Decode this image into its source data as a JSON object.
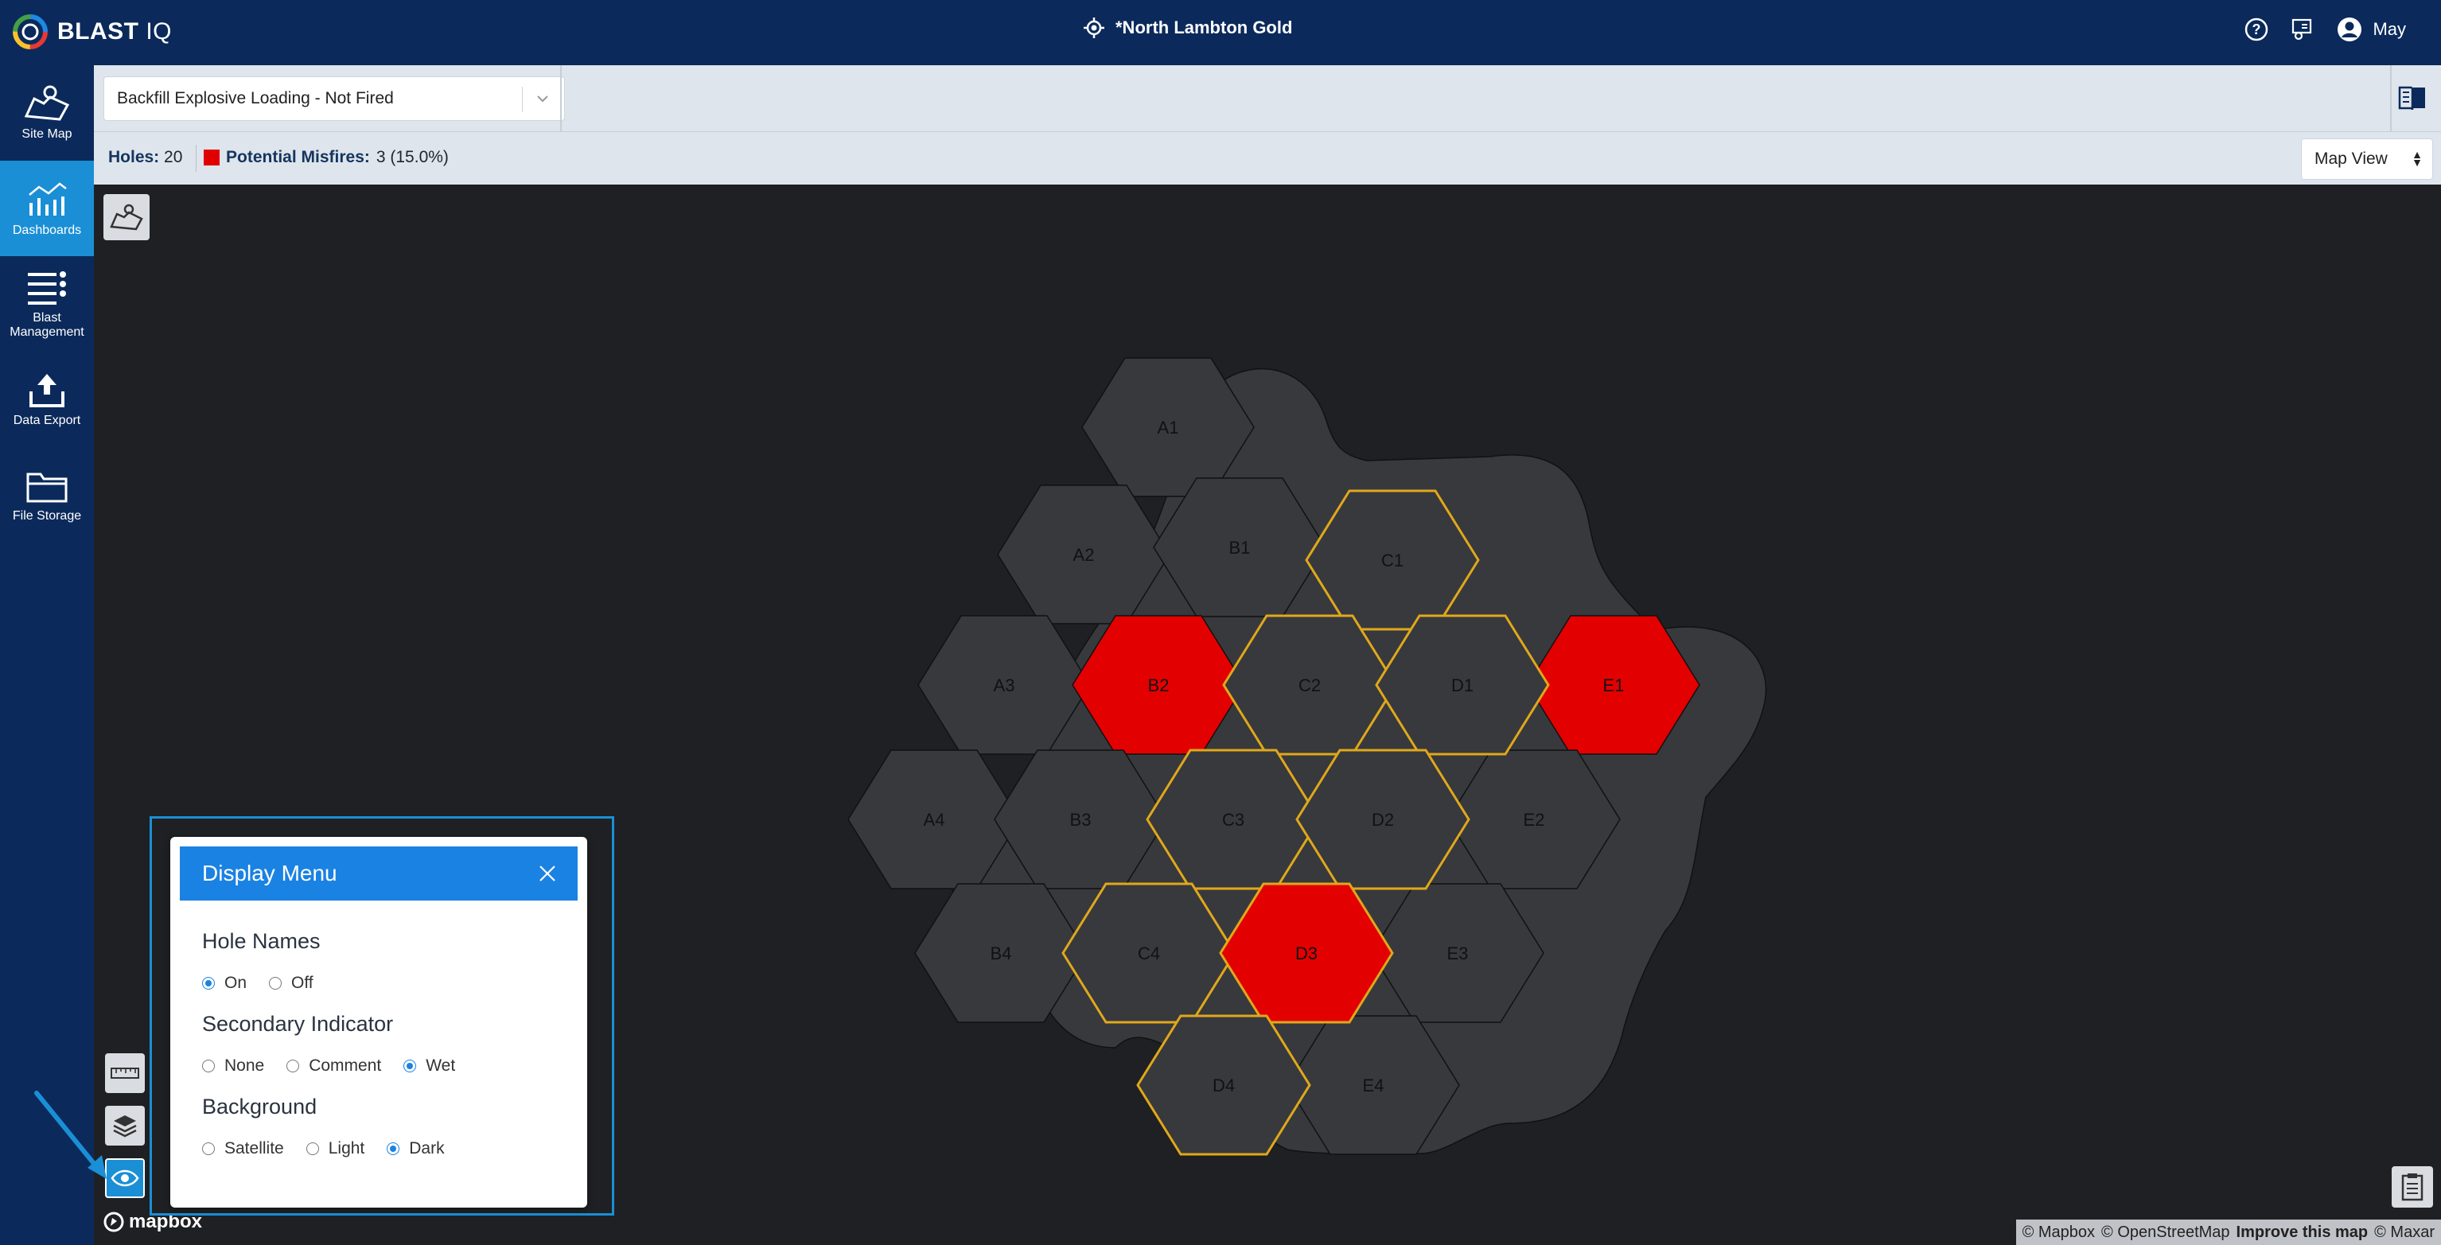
{
  "header": {
    "logo_text_bold": "BLAST",
    "logo_text_light": "IQ",
    "site_name": "*North Lambton Gold",
    "user_name": "May",
    "icons": [
      "help-icon",
      "sites-icon",
      "user-icon",
      "locate-icon"
    ]
  },
  "sidebar": {
    "items": [
      {
        "label": "Site Map",
        "icon": "map-icon",
        "active": false
      },
      {
        "label": "Dashboards",
        "icon": "dashboard-icon",
        "active": true
      },
      {
        "label": "Blast Management",
        "icon": "list-icon",
        "active": false
      },
      {
        "label": "Data Export",
        "icon": "upload-icon",
        "active": false
      },
      {
        "label": "File Storage",
        "icon": "folder-icon",
        "active": false
      }
    ]
  },
  "toolbar": {
    "dashboard_select": "Backfill Explosive Loading - Not Fired",
    "holes_label": "Holes:",
    "holes_count": "20",
    "misfires_label": "Potential Misfires:",
    "misfires_value": "3 (15.0%)",
    "view_select": "Map View"
  },
  "map": {
    "holes": [
      {
        "name": "A1",
        "status": "normal",
        "outline": false
      },
      {
        "name": "A2",
        "status": "normal",
        "outline": false
      },
      {
        "name": "A3",
        "status": "normal",
        "outline": false
      },
      {
        "name": "A4",
        "status": "normal",
        "outline": false
      },
      {
        "name": "B1",
        "status": "normal",
        "outline": false
      },
      {
        "name": "B2",
        "status": "misfire",
        "outline": false
      },
      {
        "name": "B3",
        "status": "normal",
        "outline": false
      },
      {
        "name": "B4",
        "status": "normal",
        "outline": false
      },
      {
        "name": "C1",
        "status": "normal",
        "outline": true
      },
      {
        "name": "C2",
        "status": "normal",
        "outline": true
      },
      {
        "name": "C3",
        "status": "normal",
        "outline": true
      },
      {
        "name": "C4",
        "status": "normal",
        "outline": true
      },
      {
        "name": "D1",
        "status": "normal",
        "outline": true
      },
      {
        "name": "D2",
        "status": "normal",
        "outline": true
      },
      {
        "name": "D3",
        "status": "misfire",
        "outline": true
      },
      {
        "name": "D4",
        "status": "normal",
        "outline": true
      },
      {
        "name": "E1",
        "status": "misfire",
        "outline": false
      },
      {
        "name": "E2",
        "status": "normal",
        "outline": false
      },
      {
        "name": "E3",
        "status": "normal",
        "outline": false
      },
      {
        "name": "E4",
        "status": "normal",
        "outline": false
      }
    ],
    "colors": {
      "normal": "#38393d",
      "misfire": "#e30000",
      "wet_outline": "#e0a81a",
      "background": "#1f2023"
    },
    "attribution": {
      "mapbox": "© Mapbox",
      "osm": "© OpenStreetMap",
      "improve": "Improve this map",
      "maxar": "© Maxar"
    },
    "mapbox_logo": "mapbox"
  },
  "display_menu": {
    "title": "Display Menu",
    "hole_names": {
      "label": "Hole Names",
      "options": [
        "On",
        "Off"
      ],
      "selected": "On"
    },
    "secondary_indicator": {
      "label": "Secondary Indicator",
      "options": [
        "None",
        "Comment",
        "Wet"
      ],
      "selected": "Wet"
    },
    "background": {
      "label": "Background",
      "options": [
        "Satellite",
        "Light",
        "Dark"
      ],
      "selected": "Dark"
    }
  }
}
